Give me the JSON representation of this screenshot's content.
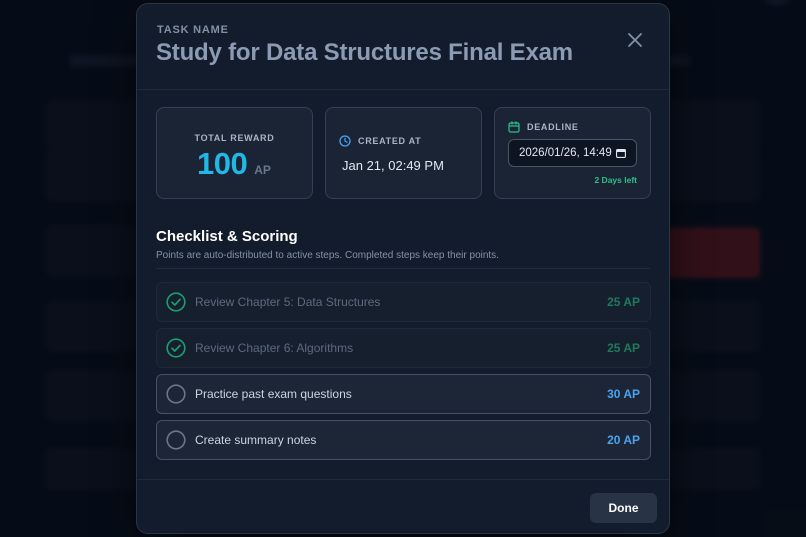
{
  "modal": {
    "task_label": "TASK NAME",
    "task_title": "Study for Data Structures Final Exam",
    "close_icon": "close-icon",
    "reward": {
      "label": "TOTAL REWARD",
      "value": "100",
      "unit": "AP"
    },
    "created": {
      "label": "CREATED AT",
      "value": "Jan 21, 02:49 PM",
      "icon": "clock-icon"
    },
    "deadline": {
      "label": "DEADLINE",
      "value": "2026/01/26, 14:49",
      "days_left": "2 Days left",
      "icon": "calendar-icon"
    },
    "checklist": {
      "title": "Checklist & Scoring",
      "subtitle": "Points are auto-distributed to active steps. Completed steps keep their points.",
      "items": [
        {
          "label": "Review Chapter 5: Data Structures",
          "points": "25 AP",
          "done": true
        },
        {
          "label": "Review Chapter 6: Algorithms",
          "points": "25 AP",
          "done": true
        },
        {
          "label": "Practice past exam questions",
          "points": "30 AP",
          "done": false
        },
        {
          "label": "Create summary notes",
          "points": "20 AP",
          "done": false
        }
      ]
    },
    "done_label": "Done"
  },
  "colors": {
    "accent_reward": "#22b8e6",
    "points_active": "#4aa3f0",
    "points_done": "#1f7a5c",
    "check_green": "#1e9e70",
    "days_left": "#2ec08a"
  }
}
